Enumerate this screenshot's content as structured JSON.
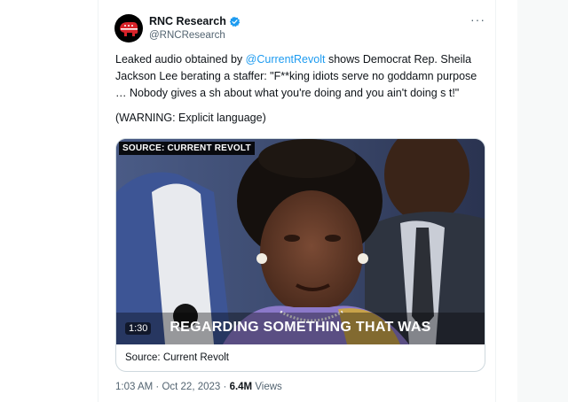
{
  "tweet": {
    "author_name": "RNC Research",
    "author_handle": "@RNCResearch",
    "more_label": "···",
    "text_part1": "Leaked audio obtained by ",
    "mention": "@CurrentRevolt",
    "text_part2": " shows Democrat Rep. Sheila Jackson Lee berating a staffer: \"F**king idiots serve no goddamn purpose … Nobody gives a sh    about what you're doing and you ain't doing s    t!\"",
    "warning": "(WARNING: Explicit language)"
  },
  "media": {
    "source_badge": "SOURCE: CURRENT REVOLT",
    "timecode": "1:30",
    "caption": "REGARDING SOMETHING THAT WAS",
    "footer": "Source: Current Revolt"
  },
  "meta": {
    "time": "1:03 AM",
    "date": "Oct 22, 2023",
    "separator": "·",
    "views_count": "6.4M",
    "views_label": "Views"
  },
  "colors": {
    "link": "#1d9bf0",
    "verified": "#1d9bf0",
    "secondary_text": "#536471",
    "logo_red": "#d8232a"
  },
  "icons": [
    "rnc-elephant-logo-icon",
    "verified-badge-icon",
    "more-options-icon"
  ]
}
